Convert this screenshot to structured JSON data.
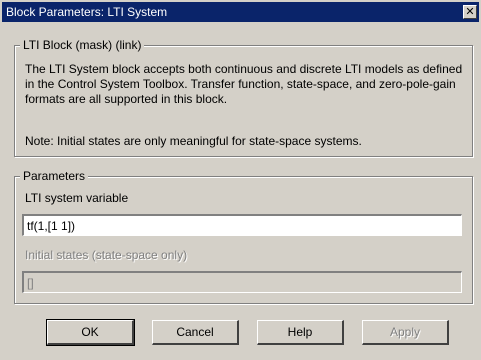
{
  "window": {
    "title": "Block Parameters: LTI System",
    "close_glyph": "✕"
  },
  "mask_group": {
    "legend": "LTI Block (mask) (link)",
    "description": "The LTI System block accepts both continuous and discrete LTI models as defined in the Control System Toolbox. Transfer function, state-space, and zero-pole-gain formats are all supported in this block.",
    "note": "Note: Initial states are only meaningful for state-space systems."
  },
  "parameters_group": {
    "legend": "Parameters",
    "lti_variable_label": "LTI system variable",
    "lti_variable_value": "tf(1,[1 1])",
    "initial_states_label": "Initial states  (state-space only)",
    "initial_states_value": "[]"
  },
  "buttons": {
    "ok": "OK",
    "cancel": "Cancel",
    "help": "Help",
    "apply": "Apply"
  }
}
